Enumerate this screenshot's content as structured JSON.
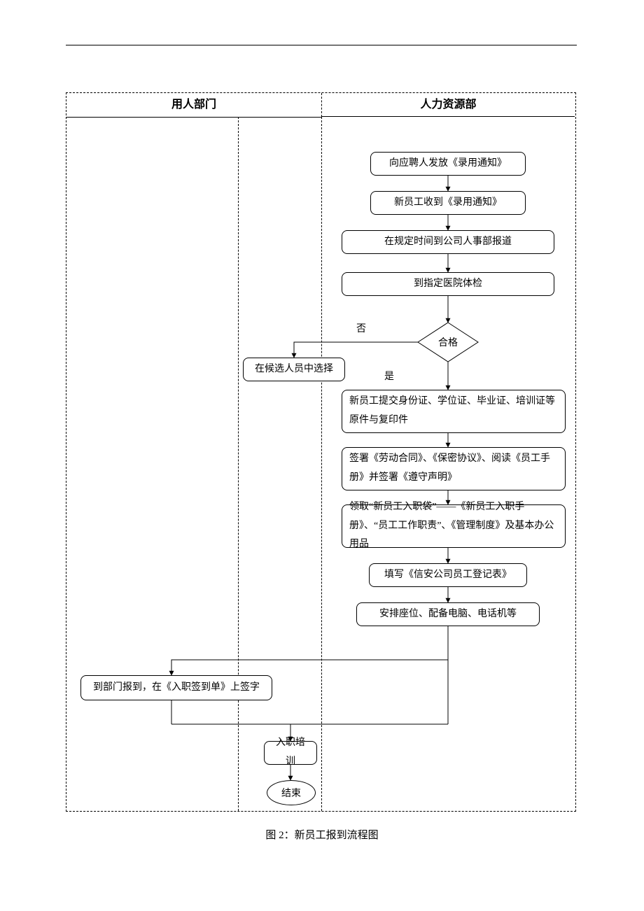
{
  "lanes": {
    "left_title": "用人部门",
    "right_title": "人力资源部"
  },
  "nodes": {
    "n1": "向应聘人发放《录用通知》",
    "n2": "新员工收到《录用通知》",
    "n3": "在规定时间到公司人事部报道",
    "n4": "到指定医院体检",
    "decision": "合格",
    "no_label": "否",
    "yes_label": "是",
    "alt": "在候选人员中选择",
    "n5": "新员工提交身份证、学位证、毕业证、培训证等原件与复印件",
    "n6": "签署《劳动合同》、《保密协议》、阅读《员工手册》并签署《遵守声明》",
    "n7": "领取“新员工入职袋”——《新员工入职手册》、“员工工作职责”、《管理制度》及基本办公用品",
    "n8": "填写《信安公司员工登记表》",
    "n9": "安排座位、配备电脑、电话机等",
    "n10": "到部门报到，在《入职签到单》上签字",
    "n11": "入职培训",
    "end": "结束"
  },
  "caption": "图 2：新员工报到流程图"
}
